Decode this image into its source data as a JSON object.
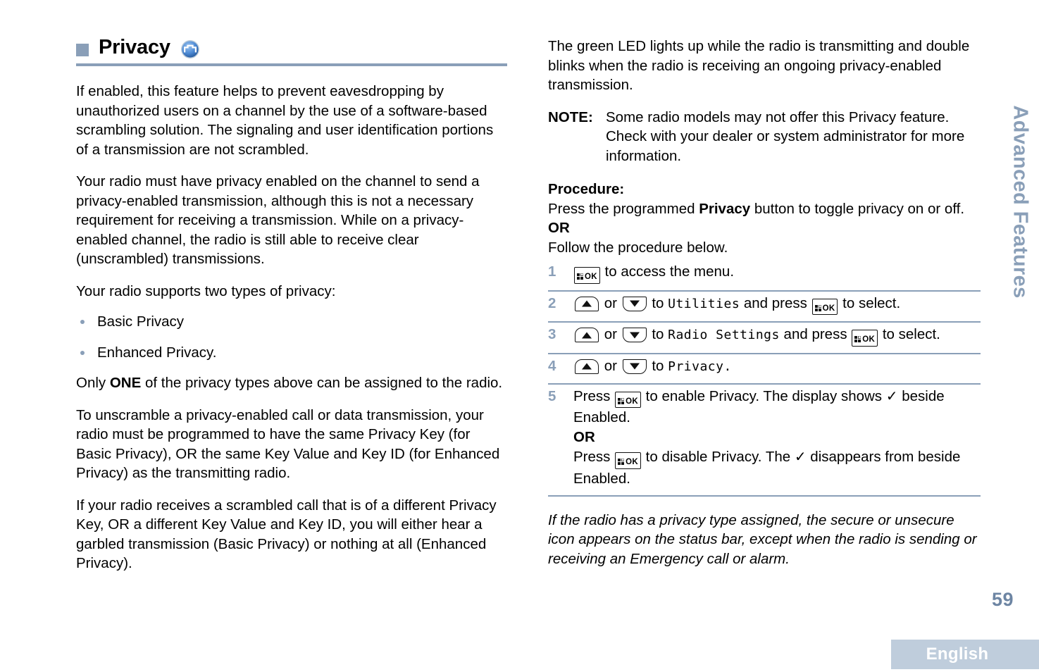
{
  "section": {
    "title": "Privacy",
    "icon": "privacy-wave-icon"
  },
  "colors": {
    "accent": "#8a9fb8",
    "page_number": "#6d85a3",
    "lang_bar_bg": "#bfcddc",
    "icon_blue": "#2f6fc0"
  },
  "left_column": {
    "paragraphs": [
      "If enabled, this feature helps to prevent eavesdropping by unauthorized users on a channel by the use of a software-based scrambling solution. The signaling and user identification portions of a transmission are not scrambled.",
      "Your radio must have privacy enabled on the channel to send a privacy-enabled transmission, although this is not a necessary requirement for receiving a transmission. While on a privacy-enabled channel, the radio is still able to receive clear (unscrambled) transmissions.",
      "Your radio supports two types of privacy:"
    ],
    "bullets": [
      "Basic Privacy",
      "Enhanced Privacy."
    ],
    "only_one": {
      "before": "Only ",
      "bold": "ONE",
      "after": " of the privacy types above can be assigned to the radio."
    },
    "paragraphs_after": [
      "To unscramble a privacy-enabled call or data transmission, your radio must be programmed to have the same Privacy Key (for Basic Privacy), OR the same Key Value and Key ID (for Enhanced Privacy) as the transmitting radio.",
      "If your radio receives a scrambled call that is of a different Privacy Key, OR a different Key Value and Key ID, you will either hear a garbled transmission (Basic Privacy) or nothing at all (Enhanced Privacy)."
    ]
  },
  "right_column": {
    "intro": "The green LED lights up while the radio is transmitting and double blinks when the radio is receiving an ongoing privacy-enabled transmission.",
    "note": {
      "label": "NOTE:",
      "text": "Some radio models may not offer this Privacy feature. Check with your dealer or system administrator for more information."
    },
    "procedure_label": "Procedure:",
    "procedure_intro": {
      "before": "Press the programmed ",
      "bold": "Privacy",
      "after": " button to toggle privacy on or off."
    },
    "or_label": "OR",
    "follow": "Follow the procedure below.",
    "steps": [
      {
        "number": "1",
        "segments": [
          {
            "type": "key-ok",
            "label": "OK"
          },
          {
            "type": "text",
            "value": " to access the menu."
          }
        ]
      },
      {
        "number": "2",
        "segments": [
          {
            "type": "key-up"
          },
          {
            "type": "text",
            "value": " or "
          },
          {
            "type": "key-down"
          },
          {
            "type": "text",
            "value": " to "
          },
          {
            "type": "menu",
            "value": "Utilities"
          },
          {
            "type": "text",
            "value": " and press "
          },
          {
            "type": "key-ok",
            "label": "OK"
          },
          {
            "type": "text",
            "value": " to select."
          }
        ]
      },
      {
        "number": "3",
        "segments": [
          {
            "type": "key-up"
          },
          {
            "type": "text",
            "value": " or "
          },
          {
            "type": "key-down"
          },
          {
            "type": "text",
            "value": " to "
          },
          {
            "type": "menu",
            "value": "Radio Settings"
          },
          {
            "type": "text",
            "value": " and press "
          },
          {
            "type": "key-ok",
            "label": "OK"
          },
          {
            "type": "text",
            "value": " to select."
          }
        ]
      },
      {
        "number": "4",
        "segments": [
          {
            "type": "key-up"
          },
          {
            "type": "text",
            "value": " or "
          },
          {
            "type": "key-down"
          },
          {
            "type": "text",
            "value": " to "
          },
          {
            "type": "menu",
            "value": "Privacy."
          }
        ]
      },
      {
        "number": "5",
        "segments": [
          {
            "type": "text",
            "value": "Press "
          },
          {
            "type": "key-ok",
            "label": "OK"
          },
          {
            "type": "text",
            "value": " to enable Privacy. The display shows "
          },
          {
            "type": "check"
          },
          {
            "type": "text",
            "value": " beside Enabled."
          },
          {
            "type": "break"
          },
          {
            "type": "bold",
            "value": "OR"
          },
          {
            "type": "break"
          },
          {
            "type": "text",
            "value": "Press "
          },
          {
            "type": "key-ok",
            "label": "OK"
          },
          {
            "type": "text",
            "value": " to disable Privacy. The "
          },
          {
            "type": "check"
          },
          {
            "type": "text",
            "value": " disappears from beside Enabled."
          }
        ]
      }
    ],
    "closing_note": "If the radio has a privacy type assigned, the secure or unsecure icon appears on the status bar, except when the radio is sending or receiving an Emergency call or alarm."
  },
  "side_tab": {
    "label": "Advanced Features"
  },
  "footer": {
    "page_number": "59",
    "language": "English"
  }
}
